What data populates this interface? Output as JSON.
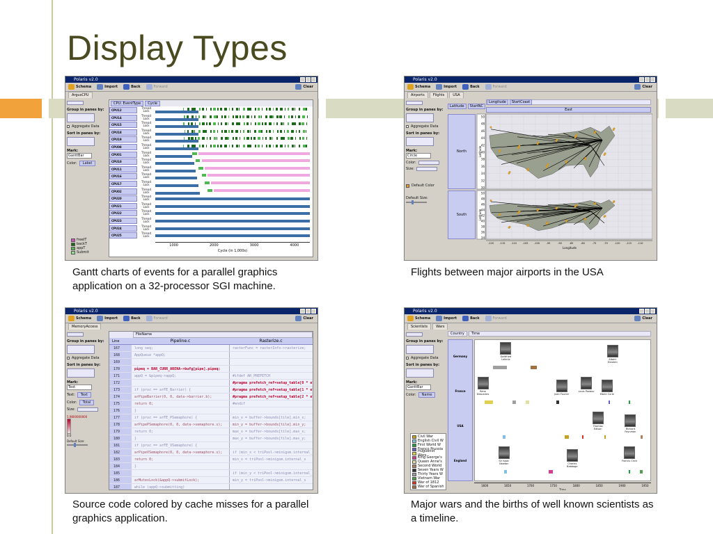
{
  "slide": {
    "title": "Display Types",
    "captions": [
      "Gantt charts of events for a parallel graphics application on a 32-processor SGI machine.",
      "Flights between major airports in the USA",
      "Source code colored by cache misses for a parallel graphics application.",
      "Major wars and the births of well known scientists as a timeline."
    ]
  },
  "app": {
    "title": "Polaris v2.0",
    "toolbar": {
      "schema": "Schema",
      "import": "Import",
      "back": "Back",
      "forward": "Forward",
      "clear": "Clear"
    }
  },
  "gantt": {
    "tab": "ArgusCPU",
    "shelf": [
      "CPU: EventType",
      "Cycle"
    ],
    "panel": {
      "group": "Group in panes by:",
      "aggregate": "Aggregate Data",
      "sort": "Sort in panes by:",
      "mark": "Mark:",
      "mark_value": "GanttBar",
      "color": "Color:",
      "color_value": "Label"
    },
    "cpus": [
      "CPU12",
      "CPU14",
      "CPU15",
      "CPU18",
      "CPU19",
      "CPU08",
      "CPU01",
      "CPU10",
      "CPU11",
      "CPU16",
      "CPU17",
      "CPU02",
      "CPU20",
      "CPU21",
      "CPU22",
      "CPU23",
      "CPU24",
      "CPU25"
    ],
    "thread": "Thread",
    "lock": "Lock",
    "axis_ticks": [
      "1000",
      "2000",
      "3000",
      "4000"
    ],
    "axis_label": "Cycle (in 1,000s)",
    "legend": [
      {
        "label": "freeIT",
        "color": "#d050c0"
      },
      {
        "label": "backT",
        "color": "#1a6a1a"
      },
      {
        "label": "appT",
        "color": "#50b850"
      },
      {
        "label": "Submit",
        "color": "#90e090"
      }
    ]
  },
  "flights": {
    "tabs": [
      "Airports",
      "Flights",
      "USA"
    ],
    "shelf": [
      "Latitude",
      "StartNC",
      "Longitude",
      "StartCoast"
    ],
    "pane_header": "East",
    "rows": [
      "North",
      "South"
    ],
    "lat_label": "Latitude",
    "lat_ticks_north": [
      "50",
      "48",
      "46",
      "44",
      "42",
      "40",
      "38",
      "36",
      "34",
      "32",
      "30"
    ],
    "lat_ticks_south": [
      "50",
      "48",
      "46",
      "44",
      "42",
      "40",
      "38",
      "36",
      "34"
    ],
    "lon_ticks": [
      "-120",
      "-115",
      "-110",
      "-105",
      "-100",
      "-95",
      "-90",
      "-85",
      "-80",
      "-75",
      "-70",
      "-120",
      "-115",
      "-110"
    ],
    "lon_label": "Longitude",
    "panel": {
      "group": "Group in panes by:",
      "aggregate": "Aggregate Data",
      "sort": "Sort in panes by:",
      "mark": "Mark:",
      "mark_value": "Circle",
      "color": "Color:",
      "size": "Size:",
      "default_color": "Default Color",
      "default_size": "Default Size:"
    }
  },
  "code": {
    "tab": "MemoryAccess",
    "shelf": "FileName",
    "line_col": "Line",
    "files": [
      "Pipeline.c",
      "Rasterize.c"
    ],
    "panel": {
      "group": "Group in panes by:",
      "aggregate": "Aggregate Data",
      "sort": "Sort in panes by:",
      "mark": "Mark:",
      "mark_value": "Text",
      "text": "Text:",
      "text_value": "Text",
      "color": "Color:",
      "color_value": "Total",
      "size": "Size:",
      "scale_max": "5,9800000000",
      "scale_min": "0.0",
      "default_size": "Default Size:"
    },
    "lines": [
      {
        "n": "167",
        "a": "long seq;",
        "b": "rasterFunc    = rasterInfo->rasterize;",
        "ca": "cold",
        "cb": "cold"
      },
      {
        "n": "168",
        "a": "AppQueue *appQ;",
        "b": "",
        "ca": "cold",
        "cb": "cold"
      },
      {
        "n": "169",
        "a": "",
        "b": "",
        "ca": "cold",
        "cb": "cold"
      },
      {
        "n": "170",
        "a": "pipeq = BAR_CURR_ARENA->bufg[pipe].pipeq;",
        "b": "",
        "ca": "hot",
        "cb": "cold"
      },
      {
        "n": "171",
        "a": "appQ = &pipeq->appQ;",
        "b": "#ifdef AR_PREFETCH",
        "ca": "cold",
        "cb": "cold"
      },
      {
        "n": "172",
        "a": "",
        "b": "#pragma prefetch_ref=setup_table[0 * elem",
        "ca": "cold",
        "cb": "hot"
      },
      {
        "n": "173",
        "a": "if (proc == arFE_Barrier) {",
        "b": "#pragma prefetch_ref=setup_table[1 * elem",
        "ca": "cold",
        "cb": "hot"
      },
      {
        "n": "174",
        "a": "arPipeBarrier(0, 0, data->barrier.b);",
        "b": "#pragma prefetch_ref=setup_table[2 * elem",
        "ca": "warm",
        "cb": "hot"
      },
      {
        "n": "175",
        "a": "return 0;",
        "b": "#endif",
        "ca": "warm",
        "cb": "cold"
      },
      {
        "n": "176",
        "a": "}",
        "b": "",
        "ca": "cold",
        "cb": "cold"
      },
      {
        "n": "177",
        "a": "if (proc == arFE_PSemaphore) {",
        "b": "min_x = buffer->bounds[tile].min_x;",
        "ca": "cold",
        "cb": "cold"
      },
      {
        "n": "178",
        "a": "arPipePSemaphore(0, 0, data->semaphore.s);",
        "b": "min_y = buffer->bounds[tile].min_y;",
        "ca": "warm",
        "cb": "warm"
      },
      {
        "n": "179",
        "a": "return 0;",
        "b": "max_x = buffer->bounds[tile].max_x;",
        "ca": "cold",
        "cb": "cold"
      },
      {
        "n": "180",
        "a": "}",
        "b": "max_y = buffer->bounds[tile].max_y;",
        "ca": "cold",
        "cb": "cold"
      },
      {
        "n": "181",
        "a": "if (proc == arFE_VSemaphore) {",
        "b": "",
        "ca": "cold",
        "cb": "cold"
      },
      {
        "n": "182",
        "a": "arPipeVSemaphore(0, 0, data->semaphore.s);",
        "b": "if (min_x < triPool->minigsm.internal_s",
        "ca": "warm",
        "cb": "cold"
      },
      {
        "n": "183",
        "a": "return 0;",
        "b": "min_x = triPool->minigsm.internal_s",
        "ca": "warm",
        "cb": "cold"
      },
      {
        "n": "184",
        "a": "}",
        "b": "",
        "ca": "cold",
        "cb": "cold"
      },
      {
        "n": "185",
        "a": "",
        "b": "if (min_y < triPool->minigsm.internal_s",
        "ca": "cold",
        "cb": "cold"
      },
      {
        "n": "186",
        "a": "arMutexLock(&appQ->submitLock);",
        "b": "min_y = triPool->minigsm.internal_s",
        "ca": "warm",
        "cb": "cold"
      },
      {
        "n": "187",
        "a": "while (appQ->submitting)",
        "b": "",
        "ca": "cold",
        "cb": "cold"
      },
      {
        "n": "188",
        "a": "arCondWait(&appQ->notSubmitting, &appQ->sub",
        "b": "if (max_x > triPool->minigsm.internal_s",
        "ca": "hot",
        "cb": "cold"
      }
    ]
  },
  "timeline": {
    "tabs": [
      "Scientists",
      "Wars"
    ],
    "shelf": [
      "Country",
      "Time"
    ],
    "panel": {
      "group": "Group in panes by:",
      "aggregate": "Aggregate Data",
      "sort": "Sort in panes by:",
      "mark": "Mark:",
      "mark_value": "GanttBar",
      "color": "Color:",
      "color_value": "Name"
    },
    "countries": [
      "Germany",
      "France",
      "USA",
      "England"
    ],
    "scientists": [
      {
        "name": "Gottfried Leibniz",
        "row": 0,
        "year": 1646
      },
      {
        "name": "Albert Einstein",
        "row": 0,
        "year": 1879
      },
      {
        "name": "Rene Descartes",
        "row": 1,
        "year": 1596
      },
      {
        "name": "Jean Fourier",
        "row": 1,
        "year": 1768
      },
      {
        "name": "Louis Pasteur",
        "row": 1,
        "year": 1822
      },
      {
        "name": "Marie Curie",
        "row": 1,
        "year": 1867
      },
      {
        "name": "Thomas Edison",
        "row": 2,
        "year": 1847
      },
      {
        "name": "Richard Feynman",
        "row": 2,
        "year": 1918
      },
      {
        "name": "Sir Isaac Newton",
        "row": 3,
        "year": 1642
      },
      {
        "name": "Charles Babbage",
        "row": 3,
        "year": 1791
      },
      {
        "name": "Francis Crick",
        "row": 3,
        "year": 1916
      }
    ],
    "wars": [
      {
        "label": "Civil War",
        "color": "#c8a020"
      },
      {
        "label": "English Civil W",
        "color": "#80c0e0"
      },
      {
        "label": "First World W",
        "color": "#20a040"
      },
      {
        "label": "Franco Prussia",
        "color": "#6060c0"
      },
      {
        "label": "Huguenot Wars",
        "color": "#e0d050"
      },
      {
        "label": "King George's",
        "color": "#d04090"
      },
      {
        "label": "Queen Anne's",
        "color": "#e0e0a0"
      },
      {
        "label": "Second World",
        "color": "#b08060"
      },
      {
        "label": "Seven Years W",
        "color": "#303030"
      },
      {
        "label": "Thirty Years W",
        "color": "#a0a0a0"
      },
      {
        "label": "Vietnam War",
        "color": "#50a050"
      },
      {
        "label": "War of 1812",
        "color": "#e03020"
      },
      {
        "label": "War of Spanish",
        "color": "#a07040"
      }
    ],
    "time_ticks": [
      "1600",
      "1650",
      "1700",
      "1750",
      "1800",
      "1850",
      "1900",
      "1950"
    ],
    "time_label": "Time"
  }
}
